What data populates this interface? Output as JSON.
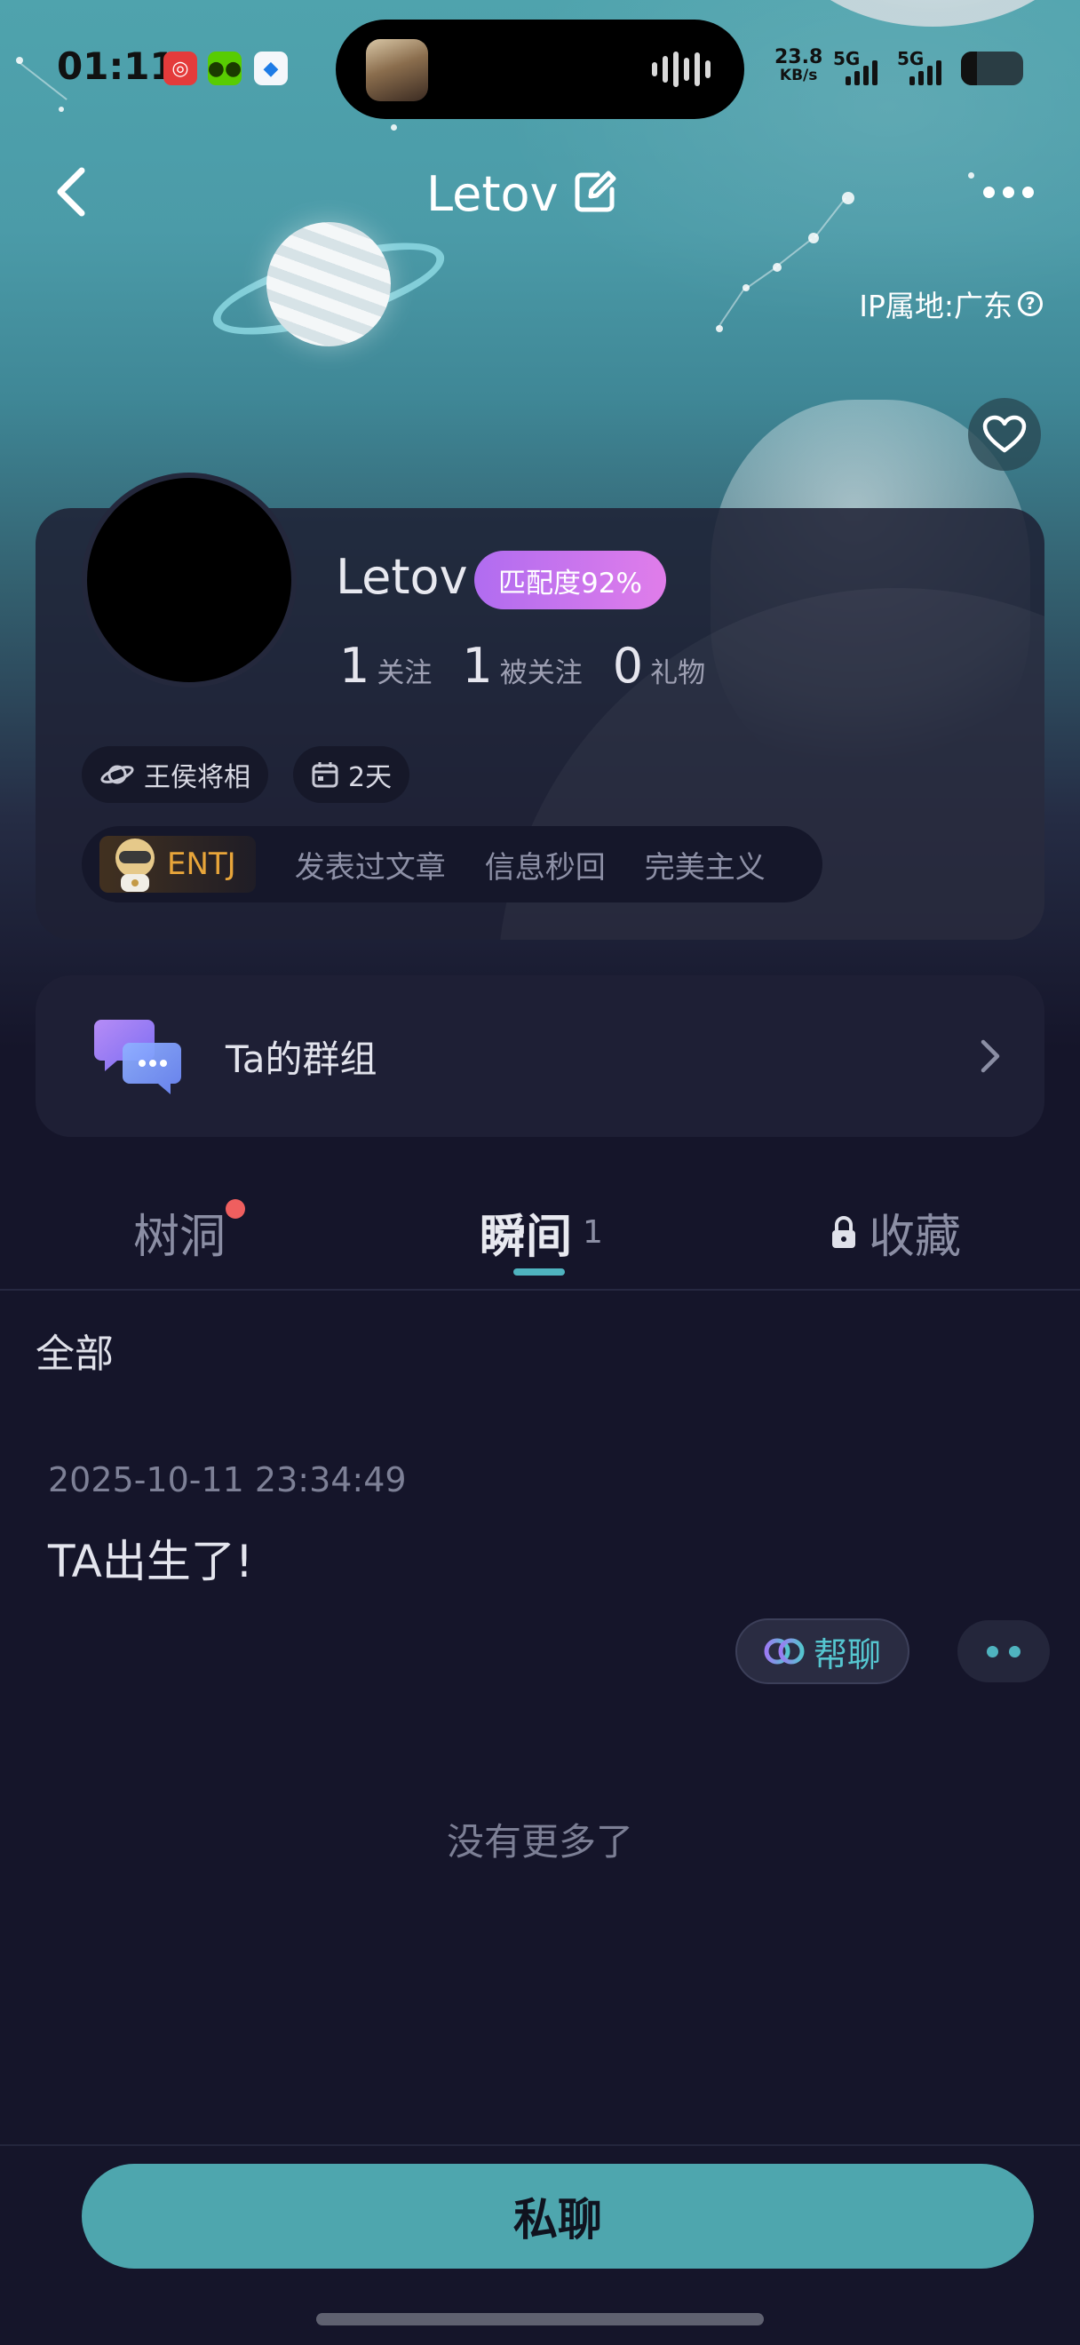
{
  "status_bar": {
    "time": "01:11",
    "net_speed_value": "23.8",
    "net_speed_unit": "KB/s",
    "sim1": "5G",
    "sim2": "5G",
    "battery_level": 0.25
  },
  "nav": {
    "title": "Letov"
  },
  "ip_location": "IP属地:广东",
  "profile": {
    "name": "Letov",
    "match": "匹配度92%",
    "stats": [
      {
        "num": "1",
        "label": "关注"
      },
      {
        "num": "1",
        "label": "被关注"
      },
      {
        "num": "0",
        "label": "礼物"
      }
    ],
    "chips": [
      "王侯将相",
      "2天"
    ],
    "mbti": "ENTJ",
    "tags": [
      "发表过文章",
      "信息秒回",
      "完美主义"
    ]
  },
  "group": {
    "label": "Ta的群组"
  },
  "tabs": {
    "treehole": "树洞",
    "moments": "瞬间",
    "moments_count": "1",
    "favorites": "收藏"
  },
  "filter": "全部",
  "post": {
    "time": "2025-10-11 23:34:49",
    "text": "TA出生了!",
    "help_chat": "帮聊"
  },
  "no_more": "没有更多了",
  "dm_button": "私聊",
  "colors": {
    "accent": "#4ea6ae",
    "badge_gradient_start": "#b06cf0",
    "badge_gradient_end": "#e07dea",
    "mbti": "#e8a53a",
    "red_dot": "#ef5f5f",
    "background": "#15152a"
  }
}
